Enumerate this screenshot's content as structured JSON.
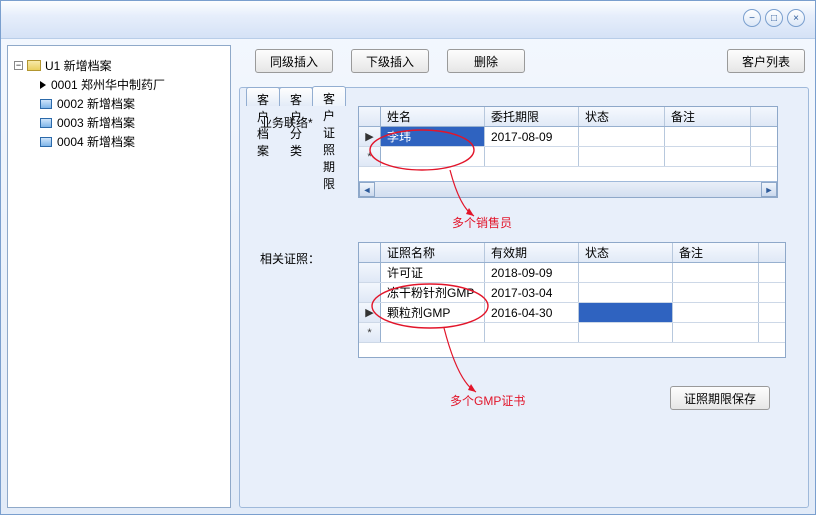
{
  "window": {
    "min_tip": "−",
    "max_tip": "□",
    "close_tip": "×"
  },
  "tree": {
    "root_label": "U1 新增档案",
    "items": [
      {
        "code": "0001",
        "label": "郑州华中制药厂",
        "iconType": "arrow"
      },
      {
        "code": "0002",
        "label": "新增档案",
        "iconType": "node"
      },
      {
        "code": "0003",
        "label": "新增档案",
        "iconType": "node"
      },
      {
        "code": "0004",
        "label": "新增档案",
        "iconType": "node"
      }
    ]
  },
  "toolbar": {
    "same_level": "同级插入",
    "child_level": "下级插入",
    "delete": "删除",
    "client_list": "客户列表"
  },
  "tabs": {
    "t1": "客户档案",
    "t2": "客户分类",
    "t3": "客户证照期限"
  },
  "section1": {
    "label": "业务联络*",
    "cols": {
      "c1": "姓名",
      "c2": "委托期限",
      "c3": "状态",
      "c4": "备注"
    },
    "row_marker_current": "▶",
    "row_marker_new": "*",
    "rows": [
      {
        "name": "李玮",
        "date": "2017-08-09",
        "status": "",
        "remark": ""
      }
    ],
    "callout": "多个销售员"
  },
  "section2": {
    "label": "相关证照：",
    "cols": {
      "c1": "证照名称",
      "c2": "有效期",
      "c3": "状态",
      "c4": "备注"
    },
    "rows": [
      {
        "name": "许可证",
        "date": "2018-09-09",
        "status": "",
        "remark": ""
      },
      {
        "name": "冻干粉针剂GMP",
        "date": "2017-03-04",
        "status": "",
        "remark": ""
      },
      {
        "name": "颗粒剂GMP",
        "date": "2016-04-30",
        "status": "",
        "remark": ""
      }
    ],
    "callout": "多个GMP证书",
    "save_btn": "证照期限保存"
  }
}
